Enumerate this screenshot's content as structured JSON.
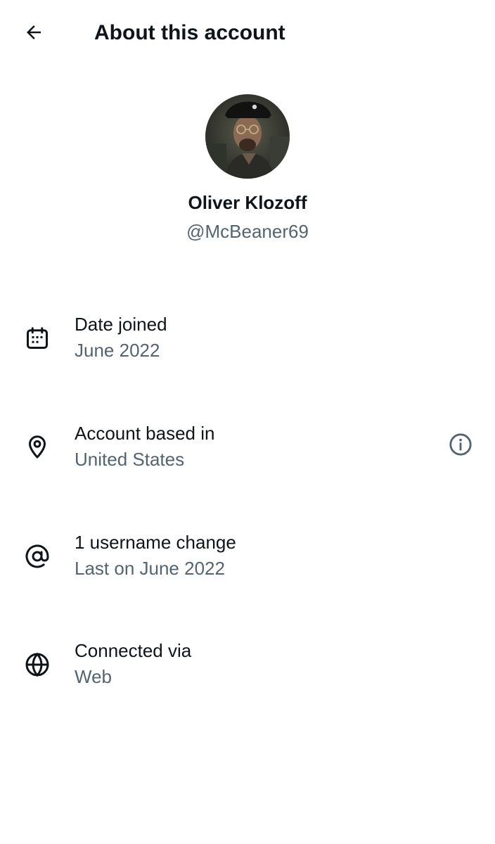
{
  "header": {
    "title": "About this account",
    "back_icon": "arrow-left-icon"
  },
  "profile": {
    "display_name": "Oliver Klozoff",
    "handle": "@McBeaner69",
    "avatar_icon": "profile-photo"
  },
  "details": [
    {
      "icon": "calendar-icon",
      "label": "Date joined",
      "value": "June 2022"
    },
    {
      "icon": "location-pin-icon",
      "label": "Account based in",
      "value": "United States",
      "action_icon": "info-icon"
    },
    {
      "icon": "at-sign-icon",
      "label": "1 username change",
      "value": "Last on June 2022"
    },
    {
      "icon": "globe-icon",
      "label": "Connected via",
      "value": "Web"
    }
  ],
  "colors": {
    "text_primary": "#0f1419",
    "text_secondary": "#536471",
    "background": "#ffffff"
  }
}
